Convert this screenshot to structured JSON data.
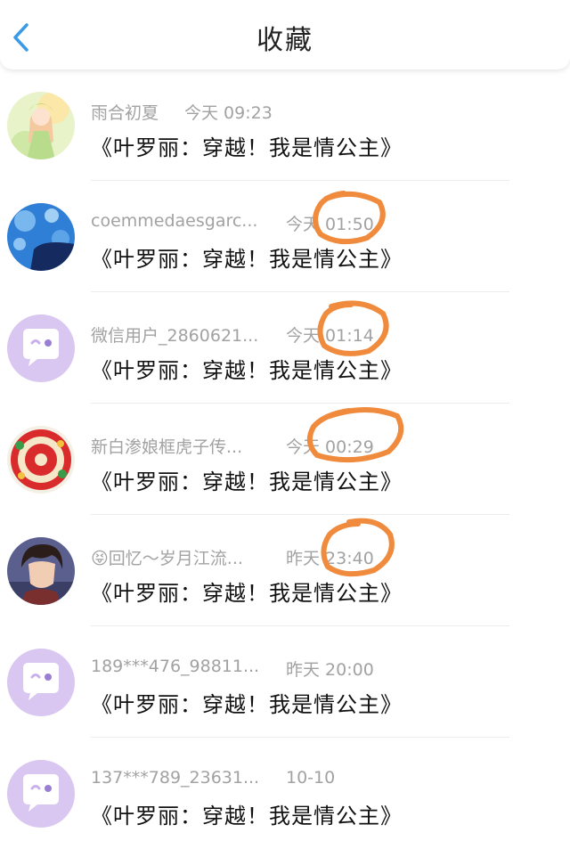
{
  "header": {
    "title": "收藏"
  },
  "colors": {
    "accent": "#3b9ae6",
    "annotation": "#f08a3c",
    "placeholder_avatar": "#d9c6f1"
  },
  "items": [
    {
      "name": "雨合初夏",
      "time": "今天 09:23",
      "content": "《叶罗丽：穿越！我是情公主》",
      "avatar": "anime-girl"
    },
    {
      "name": "coemmedaesgarc...",
      "time": "今天 01:50",
      "content": "《叶罗丽：穿越！我是情公主》",
      "avatar": "blue-bokeh"
    },
    {
      "name": "微信用户_2860621...",
      "time": "今天 01:14",
      "content": "《叶罗丽：穿越！我是情公主》",
      "avatar": "default-chat"
    },
    {
      "name": "新白渗娘框虎子传...",
      "time": "今天 00:29",
      "content": "《叶罗丽：穿越！我是情公主》",
      "avatar": "red-paper-cut"
    },
    {
      "name": "😝回忆～岁月江流...",
      "time": "昨天 23:40",
      "content": "《叶罗丽：穿越！我是情公主》",
      "avatar": "anime-boy"
    },
    {
      "name": "189***476_98811...",
      "time": "昨天 20:00",
      "content": "《叶罗丽：穿越！我是情公主》",
      "avatar": "default-chat"
    },
    {
      "name": "137***789_23631...",
      "time": "10-10",
      "content": "《叶罗丽：穿越！我是情公主》",
      "avatar": "default-chat"
    }
  ]
}
